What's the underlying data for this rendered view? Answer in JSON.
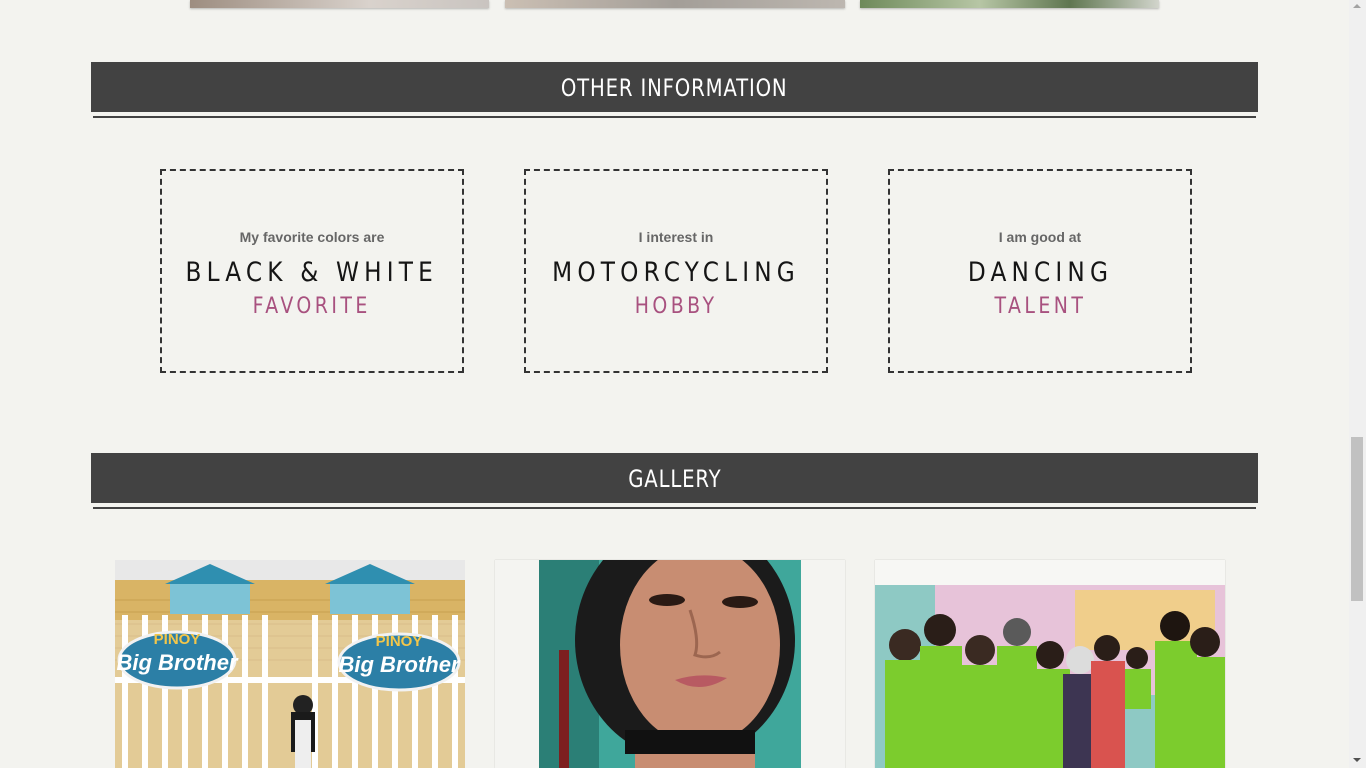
{
  "sections": {
    "other_information": "OTHER INFORMATION",
    "gallery": "GALLERY"
  },
  "info_cards": [
    {
      "intro": "My favorite colors are",
      "value": "BLACK & WHITE",
      "kind": "FAVORITE"
    },
    {
      "intro": "I interest in",
      "value": "MOTORCYCLING",
      "kind": "HOBBY"
    },
    {
      "intro": "I am good at",
      "value": "DANCING",
      "kind": "TALENT"
    }
  ],
  "gallery_photos": [
    {
      "sign_top": "PINOY",
      "sign_bottom": "Big Brother"
    }
  ],
  "colors": {
    "page_bg": "#f3f3ef",
    "bar_bg": "#424242",
    "accent_pink": "#a8517f"
  }
}
